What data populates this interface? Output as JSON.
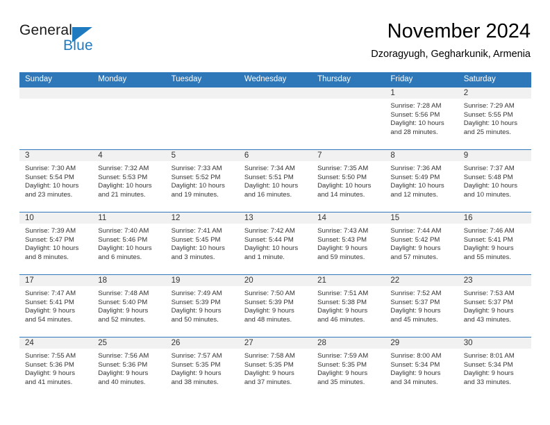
{
  "brand": {
    "name_part1": "General",
    "name_part2": "Blue",
    "accent_color": "#1f7ac0",
    "triangle_icon": "triangle-logo-icon"
  },
  "header": {
    "title": "November 2024",
    "subtitle": "Dzoragyugh, Gegharkunik, Armenia",
    "header_bg_color": "#2e77b8",
    "daynum_bg_color": "#f1f1f1"
  },
  "weekday_headers": [
    "Sunday",
    "Monday",
    "Tuesday",
    "Wednesday",
    "Thursday",
    "Friday",
    "Saturday"
  ],
  "weeks": [
    [
      {
        "day": "",
        "empty": true,
        "sunrise": "",
        "sunset": "",
        "daylight1": "",
        "daylight2": ""
      },
      {
        "day": "",
        "empty": true,
        "sunrise": "",
        "sunset": "",
        "daylight1": "",
        "daylight2": ""
      },
      {
        "day": "",
        "empty": true,
        "sunrise": "",
        "sunset": "",
        "daylight1": "",
        "daylight2": ""
      },
      {
        "day": "",
        "empty": true,
        "sunrise": "",
        "sunset": "",
        "daylight1": "",
        "daylight2": ""
      },
      {
        "day": "",
        "empty": true,
        "sunrise": "",
        "sunset": "",
        "daylight1": "",
        "daylight2": ""
      },
      {
        "day": "1",
        "empty": false,
        "sunrise": "Sunrise: 7:28 AM",
        "sunset": "Sunset: 5:56 PM",
        "daylight1": "Daylight: 10 hours",
        "daylight2": "and 28 minutes."
      },
      {
        "day": "2",
        "empty": false,
        "sunrise": "Sunrise: 7:29 AM",
        "sunset": "Sunset: 5:55 PM",
        "daylight1": "Daylight: 10 hours",
        "daylight2": "and 25 minutes."
      }
    ],
    [
      {
        "day": "3",
        "empty": false,
        "sunrise": "Sunrise: 7:30 AM",
        "sunset": "Sunset: 5:54 PM",
        "daylight1": "Daylight: 10 hours",
        "daylight2": "and 23 minutes."
      },
      {
        "day": "4",
        "empty": false,
        "sunrise": "Sunrise: 7:32 AM",
        "sunset": "Sunset: 5:53 PM",
        "daylight1": "Daylight: 10 hours",
        "daylight2": "and 21 minutes."
      },
      {
        "day": "5",
        "empty": false,
        "sunrise": "Sunrise: 7:33 AM",
        "sunset": "Sunset: 5:52 PM",
        "daylight1": "Daylight: 10 hours",
        "daylight2": "and 19 minutes."
      },
      {
        "day": "6",
        "empty": false,
        "sunrise": "Sunrise: 7:34 AM",
        "sunset": "Sunset: 5:51 PM",
        "daylight1": "Daylight: 10 hours",
        "daylight2": "and 16 minutes."
      },
      {
        "day": "7",
        "empty": false,
        "sunrise": "Sunrise: 7:35 AM",
        "sunset": "Sunset: 5:50 PM",
        "daylight1": "Daylight: 10 hours",
        "daylight2": "and 14 minutes."
      },
      {
        "day": "8",
        "empty": false,
        "sunrise": "Sunrise: 7:36 AM",
        "sunset": "Sunset: 5:49 PM",
        "daylight1": "Daylight: 10 hours",
        "daylight2": "and 12 minutes."
      },
      {
        "day": "9",
        "empty": false,
        "sunrise": "Sunrise: 7:37 AM",
        "sunset": "Sunset: 5:48 PM",
        "daylight1": "Daylight: 10 hours",
        "daylight2": "and 10 minutes."
      }
    ],
    [
      {
        "day": "10",
        "empty": false,
        "sunrise": "Sunrise: 7:39 AM",
        "sunset": "Sunset: 5:47 PM",
        "daylight1": "Daylight: 10 hours",
        "daylight2": "and 8 minutes."
      },
      {
        "day": "11",
        "empty": false,
        "sunrise": "Sunrise: 7:40 AM",
        "sunset": "Sunset: 5:46 PM",
        "daylight1": "Daylight: 10 hours",
        "daylight2": "and 6 minutes."
      },
      {
        "day": "12",
        "empty": false,
        "sunrise": "Sunrise: 7:41 AM",
        "sunset": "Sunset: 5:45 PM",
        "daylight1": "Daylight: 10 hours",
        "daylight2": "and 3 minutes."
      },
      {
        "day": "13",
        "empty": false,
        "sunrise": "Sunrise: 7:42 AM",
        "sunset": "Sunset: 5:44 PM",
        "daylight1": "Daylight: 10 hours",
        "daylight2": "and 1 minute."
      },
      {
        "day": "14",
        "empty": false,
        "sunrise": "Sunrise: 7:43 AM",
        "sunset": "Sunset: 5:43 PM",
        "daylight1": "Daylight: 9 hours",
        "daylight2": "and 59 minutes."
      },
      {
        "day": "15",
        "empty": false,
        "sunrise": "Sunrise: 7:44 AM",
        "sunset": "Sunset: 5:42 PM",
        "daylight1": "Daylight: 9 hours",
        "daylight2": "and 57 minutes."
      },
      {
        "day": "16",
        "empty": false,
        "sunrise": "Sunrise: 7:46 AM",
        "sunset": "Sunset: 5:41 PM",
        "daylight1": "Daylight: 9 hours",
        "daylight2": "and 55 minutes."
      }
    ],
    [
      {
        "day": "17",
        "empty": false,
        "sunrise": "Sunrise: 7:47 AM",
        "sunset": "Sunset: 5:41 PM",
        "daylight1": "Daylight: 9 hours",
        "daylight2": "and 54 minutes."
      },
      {
        "day": "18",
        "empty": false,
        "sunrise": "Sunrise: 7:48 AM",
        "sunset": "Sunset: 5:40 PM",
        "daylight1": "Daylight: 9 hours",
        "daylight2": "and 52 minutes."
      },
      {
        "day": "19",
        "empty": false,
        "sunrise": "Sunrise: 7:49 AM",
        "sunset": "Sunset: 5:39 PM",
        "daylight1": "Daylight: 9 hours",
        "daylight2": "and 50 minutes."
      },
      {
        "day": "20",
        "empty": false,
        "sunrise": "Sunrise: 7:50 AM",
        "sunset": "Sunset: 5:39 PM",
        "daylight1": "Daylight: 9 hours",
        "daylight2": "and 48 minutes."
      },
      {
        "day": "21",
        "empty": false,
        "sunrise": "Sunrise: 7:51 AM",
        "sunset": "Sunset: 5:38 PM",
        "daylight1": "Daylight: 9 hours",
        "daylight2": "and 46 minutes."
      },
      {
        "day": "22",
        "empty": false,
        "sunrise": "Sunrise: 7:52 AM",
        "sunset": "Sunset: 5:37 PM",
        "daylight1": "Daylight: 9 hours",
        "daylight2": "and 45 minutes."
      },
      {
        "day": "23",
        "empty": false,
        "sunrise": "Sunrise: 7:53 AM",
        "sunset": "Sunset: 5:37 PM",
        "daylight1": "Daylight: 9 hours",
        "daylight2": "and 43 minutes."
      }
    ],
    [
      {
        "day": "24",
        "empty": false,
        "sunrise": "Sunrise: 7:55 AM",
        "sunset": "Sunset: 5:36 PM",
        "daylight1": "Daylight: 9 hours",
        "daylight2": "and 41 minutes."
      },
      {
        "day": "25",
        "empty": false,
        "sunrise": "Sunrise: 7:56 AM",
        "sunset": "Sunset: 5:36 PM",
        "daylight1": "Daylight: 9 hours",
        "daylight2": "and 40 minutes."
      },
      {
        "day": "26",
        "empty": false,
        "sunrise": "Sunrise: 7:57 AM",
        "sunset": "Sunset: 5:35 PM",
        "daylight1": "Daylight: 9 hours",
        "daylight2": "and 38 minutes."
      },
      {
        "day": "27",
        "empty": false,
        "sunrise": "Sunrise: 7:58 AM",
        "sunset": "Sunset: 5:35 PM",
        "daylight1": "Daylight: 9 hours",
        "daylight2": "and 37 minutes."
      },
      {
        "day": "28",
        "empty": false,
        "sunrise": "Sunrise: 7:59 AM",
        "sunset": "Sunset: 5:35 PM",
        "daylight1": "Daylight: 9 hours",
        "daylight2": "and 35 minutes."
      },
      {
        "day": "29",
        "empty": false,
        "sunrise": "Sunrise: 8:00 AM",
        "sunset": "Sunset: 5:34 PM",
        "daylight1": "Daylight: 9 hours",
        "daylight2": "and 34 minutes."
      },
      {
        "day": "30",
        "empty": false,
        "sunrise": "Sunrise: 8:01 AM",
        "sunset": "Sunset: 5:34 PM",
        "daylight1": "Daylight: 9 hours",
        "daylight2": "and 33 minutes."
      }
    ]
  ]
}
